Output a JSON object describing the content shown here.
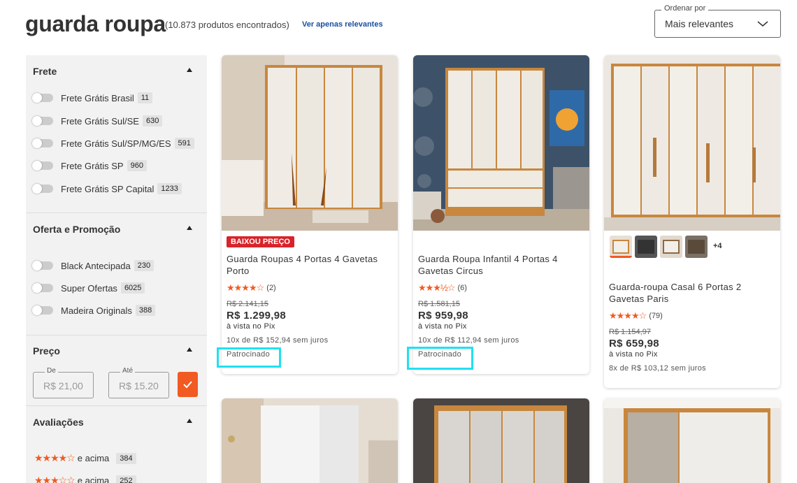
{
  "header": {
    "title": "guarda roupa",
    "count": "(10.873 produtos encontrados)",
    "relevant_link": "Ver apenas relevantes",
    "sort_label": "Ordenar por",
    "sort_value": "Mais relevantes"
  },
  "sidebar": {
    "frete": {
      "title": "Frete",
      "items": [
        {
          "label": "Frete Grátis Brasil",
          "count": "11"
        },
        {
          "label": "Frete Grátis Sul/SE",
          "count": "630"
        },
        {
          "label": "Frete Grátis Sul/SP/MG/ES",
          "count": "591"
        },
        {
          "label": "Frete Grátis SP",
          "count": "960"
        },
        {
          "label": "Frete Grátis SP Capital",
          "count": "1233"
        }
      ]
    },
    "oferta": {
      "title": "Oferta e Promoção",
      "items": [
        {
          "label": "Black Antecipada",
          "count": "230"
        },
        {
          "label": "Super Ofertas",
          "count": "6025"
        },
        {
          "label": "Madeira Originals",
          "count": "388"
        }
      ]
    },
    "preco": {
      "title": "Preço",
      "de_label": "De",
      "ate_label": "Até",
      "de_placeholder": "R$ 21,00",
      "ate_placeholder": "R$ 15.20"
    },
    "avaliacoes": {
      "title": "Avaliações",
      "items": [
        {
          "stars": 4,
          "label": "e acima",
          "count": "384"
        },
        {
          "stars": 3,
          "label": "e acima",
          "count": "252"
        }
      ]
    }
  },
  "products": [
    {
      "badge": "BAIXOU PREÇO",
      "name": "Guarda Roupas 4 Portas 4 Gavetas Porto",
      "rating": 4.0,
      "reviews": "(2)",
      "old_price": "R$ 2.141,15",
      "price": "R$ 1.299,98",
      "pix": "à vista no Pix",
      "installments": "10x de R$ 152,94 sem juros",
      "sponsored": "Patrocinado"
    },
    {
      "name": "Guarda Roupa Infantil 4 Portas 4 Gavetas Circus",
      "rating": 3.5,
      "reviews": "(6)",
      "old_price": "R$ 1.581,15",
      "price": "R$ 959,98",
      "pix": "à vista no Pix",
      "installments": "10x de R$ 112,94 sem juros",
      "sponsored": "Patrocinado"
    },
    {
      "variants_more": "+4",
      "name": "Guarda-roupa Casal 6 Portas 2 Gavetas Paris",
      "rating": 4.0,
      "reviews": "(79)",
      "old_price": "R$ 1.154,97",
      "price": "R$ 659,98",
      "pix": "à vista no Pix",
      "installments": "8x de R$ 103,12 sem juros"
    }
  ],
  "colors": {
    "accent": "#f15a22",
    "link": "#1a4fa0",
    "badge": "#d8232a",
    "highlight": "#20e0f0"
  }
}
